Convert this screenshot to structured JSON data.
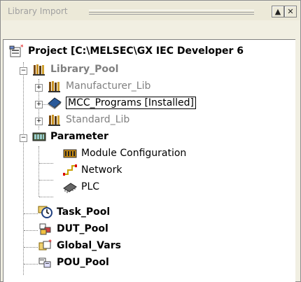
{
  "panel": {
    "title": "Library Import",
    "dock_button": "▲",
    "close_button": "✕"
  },
  "tree": {
    "project": "Project [C:\\MELSEC\\GX IEC Developer 6",
    "library_pool": "Library_Pool",
    "manufacturer_lib": "Manufacturer_Lib",
    "mcc_programs": "MCC_Programs [Installed]",
    "standard_lib": "Standard_Lib",
    "parameter": "Parameter",
    "module_configuration": "Module Configuration",
    "network": "Network",
    "plc": "PLC",
    "task_pool": "Task_Pool",
    "dut_pool": "DUT_Pool",
    "global_vars": "Global_Vars",
    "pou_pool": "POU_Pool"
  },
  "expanders": {
    "collapsed": "+",
    "expanded": "−"
  },
  "colors": {
    "panel_bg": "#f1efe2",
    "disabled_text": "#808080",
    "selection_border": "#000000"
  }
}
